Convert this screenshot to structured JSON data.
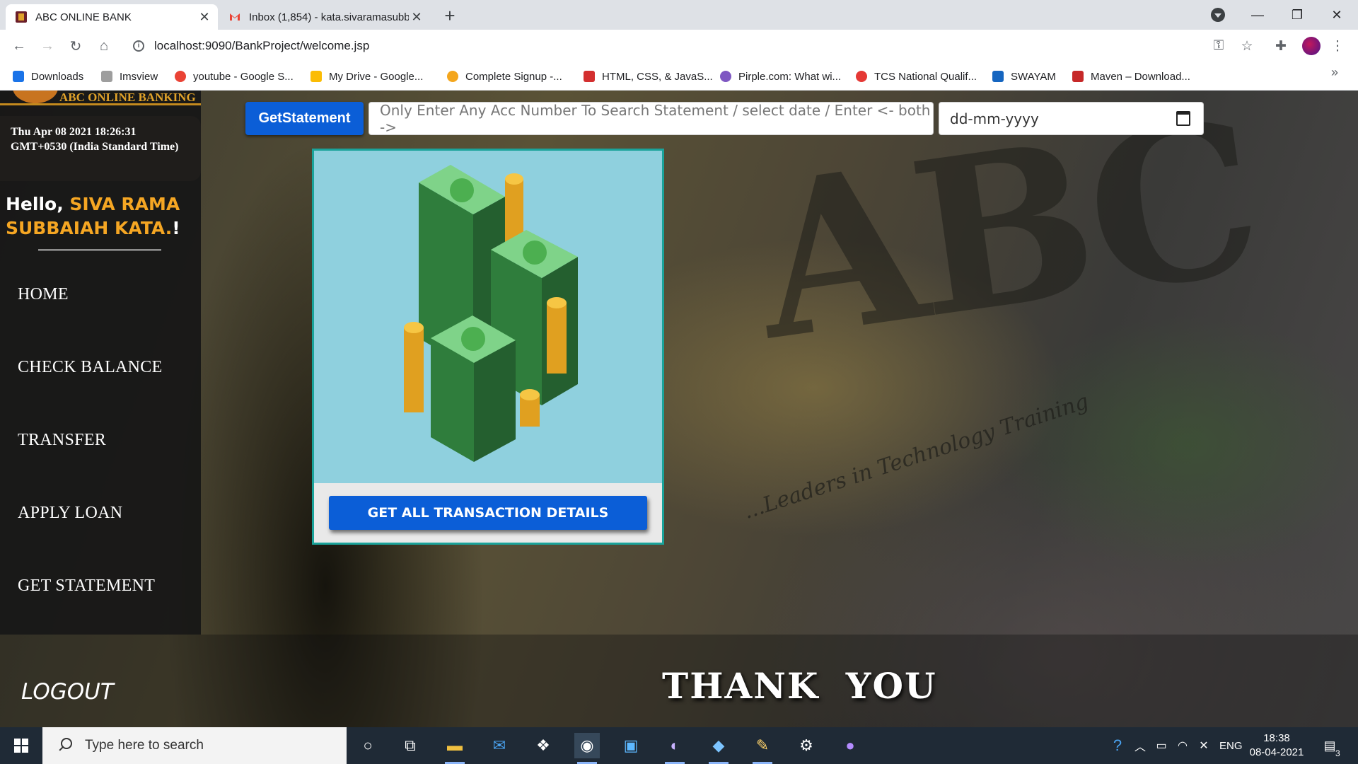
{
  "browser": {
    "tabs": [
      {
        "title": "ABC ONLINE BANK",
        "active": true
      },
      {
        "title": "Inbox (1,854) - kata.sivaramasubb",
        "active": false
      }
    ],
    "address": "localhost:9090/BankProject/welcome.jsp",
    "bookmarks": [
      {
        "label": "Downloads",
        "icon": "download-icon",
        "color": "#1a73e8"
      },
      {
        "label": "Imsview",
        "icon": "page-icon",
        "color": "#9e9e9e"
      },
      {
        "label": "youtube - Google S...",
        "icon": "google-icon",
        "color": "#ea4335"
      },
      {
        "label": "My Drive - Google...",
        "icon": "drive-icon",
        "color": "#fbbc04"
      },
      {
        "label": "Complete Signup -...",
        "icon": "gear-icon",
        "color": "#f4a61d"
      },
      {
        "label": "HTML, CSS, & JavaS...",
        "icon": "code-icon",
        "color": "#d32f2f"
      },
      {
        "label": "Pirple.com: What wi...",
        "icon": "pirple-icon",
        "color": "#7e57c2"
      },
      {
        "label": "TCS National Qualif...",
        "icon": "power-icon",
        "color": "#e53935"
      },
      {
        "label": "SWAYAM",
        "icon": "swayam-icon",
        "color": "#1565c0"
      },
      {
        "label": "Maven – Download...",
        "icon": "feather-icon",
        "color": "#c62828"
      }
    ]
  },
  "sidebar": {
    "brand": "ABC ONLINE BANKING",
    "datetime": "Thu Apr 08 2021 18:26:31 GMT+0530 (India Standard Time)",
    "greeting": "Hello, ",
    "username": "SIVA RAMA SUBBAIAH KATA.",
    "greeting_end": "!",
    "nav": [
      "HOME",
      "CHECK BALANCE",
      "TRANSFER",
      "APPLY LOAN",
      "GET STATEMENT"
    ],
    "logout": "LOGOUT"
  },
  "search": {
    "button": "GetStatement",
    "acc_placeholder": "Only Enter Any Acc Number To Search Statement / select date / Enter <- both ->",
    "date_placeholder": "dd-mm-yyyy"
  },
  "card": {
    "button": "GET ALL TRANSACTION DETAILS"
  },
  "footer": {
    "thanks": "THANK YOU"
  },
  "background": {
    "letters": "ABC",
    "tagline": "...Leaders in Technology Training"
  },
  "taskbar": {
    "search_placeholder": "Type here to search",
    "language": "ENG",
    "time": "18:38",
    "date": "08-04-2021",
    "notifications": "3"
  },
  "colors": {
    "accent_blue": "#0b5ed7",
    "name_orange": "#f5a623",
    "brand_gold": "#e0a22a",
    "card_border": "#1aa39a"
  }
}
